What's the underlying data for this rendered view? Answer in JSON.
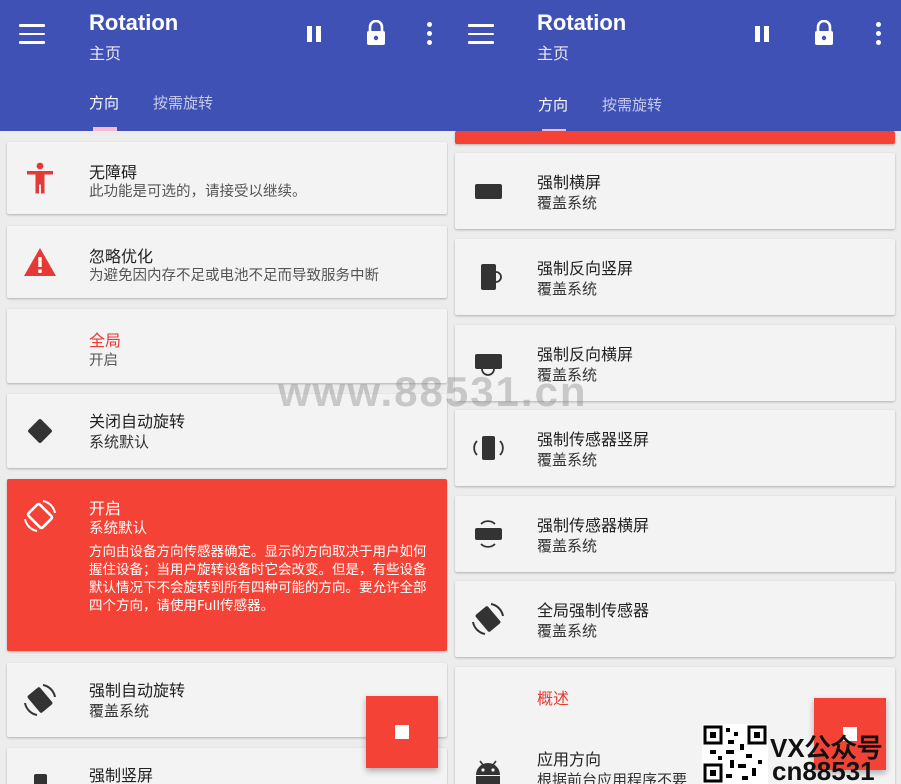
{
  "colors": {
    "primary": "#3f51b5",
    "accent": "#f44336",
    "indicator": "#f8bbd0"
  },
  "left": {
    "appbar": {
      "title": "Rotation",
      "subtitle": "主页"
    },
    "tabs": [
      {
        "label": "方向",
        "active": true
      },
      {
        "label": "按需旋转",
        "active": false
      }
    ],
    "cards": [
      {
        "icon": "accessibility-icon",
        "title": "无障碍",
        "subtitle": "此功能是可选的，请接受以继续。"
      },
      {
        "icon": "warning-icon",
        "title": "忽略优化",
        "subtitle": "为避免因内存不足或电池不足而导致服务中断"
      },
      {
        "title": "全局",
        "subtitle": "开启"
      },
      {
        "icon": "rotation-off-icon",
        "title": "关闭自动旋转",
        "subtitle": "系统默认"
      },
      {
        "icon": "auto-rotate-icon",
        "title": "开启",
        "subtitle": "系统默认",
        "description": "方向由设备方向传感器确定。显示的方向取决于用户如何握住设备；当用户旋转设备时它会改变。但是，有些设备默认情况下不会旋转到所有四种可能的方向。要允许全部四个方向，请使用Full传感器。"
      },
      {
        "icon": "forced-auto-rotate-icon",
        "title": "强制自动旋转",
        "subtitle": "覆盖系统"
      },
      {
        "icon": "portrait-icon",
        "title": "强制竖屏"
      }
    ]
  },
  "right": {
    "appbar": {
      "title": "Rotation",
      "subtitle": "主页"
    },
    "tabs": [
      {
        "label": "方向",
        "active": true
      },
      {
        "label": "按需旋转",
        "active": false
      }
    ],
    "cards": [
      {
        "icon": "landscape-icon",
        "title": "强制横屏",
        "subtitle": "覆盖系统"
      },
      {
        "icon": "reverse-portrait-icon",
        "title": "强制反向竖屏",
        "subtitle": "覆盖系统"
      },
      {
        "icon": "reverse-landscape-icon",
        "title": "强制反向横屏",
        "subtitle": "覆盖系统"
      },
      {
        "icon": "sensor-portrait-icon",
        "title": "强制传感器竖屏",
        "subtitle": "覆盖系统"
      },
      {
        "icon": "sensor-landscape-icon",
        "title": "强制传感器横屏",
        "subtitle": "覆盖系统"
      },
      {
        "icon": "full-sensor-icon",
        "title": "全局强制传感器",
        "subtitle": "覆盖系统"
      },
      {
        "title": "概述"
      },
      {
        "icon": "android-icon",
        "title": "应用方向",
        "subtitle": "根据前台应用程序不要"
      }
    ]
  },
  "watermark": "www.88531.cn",
  "overlay": {
    "line1": "VX公众号",
    "line2": "cn88531"
  }
}
